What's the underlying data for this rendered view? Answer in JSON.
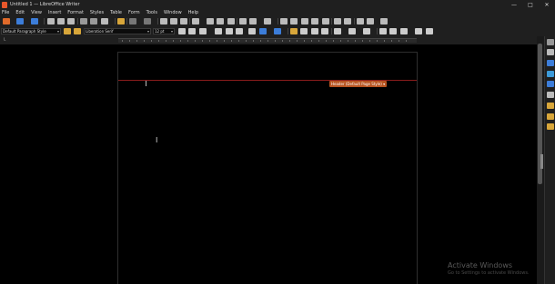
{
  "window": {
    "title": "Untitled 1 — LibreOffice Writer",
    "controls": {
      "minimize": "—",
      "maximize": "□",
      "close": "✕"
    }
  },
  "menubar": {
    "items": [
      "File",
      "Edit",
      "View",
      "Insert",
      "Format",
      "Styles",
      "Table",
      "Form",
      "Tools",
      "Window",
      "Help"
    ]
  },
  "formatting": {
    "paragraph_style": "Default Paragraph Style",
    "font_name": "Liberation Serif",
    "font_size": "12 pt"
  },
  "document": {
    "header_label": "Header (Default Page Style) ▾"
  },
  "watermark": {
    "title": "Activate Windows",
    "subtitle": "Go to Settings to activate Windows."
  },
  "colors": {
    "app_accent": "#e8572b",
    "header_tag": "#b85420",
    "header_line": "#8a1c1c",
    "chrome": "#1f1f1f",
    "canvas": "#000000"
  }
}
